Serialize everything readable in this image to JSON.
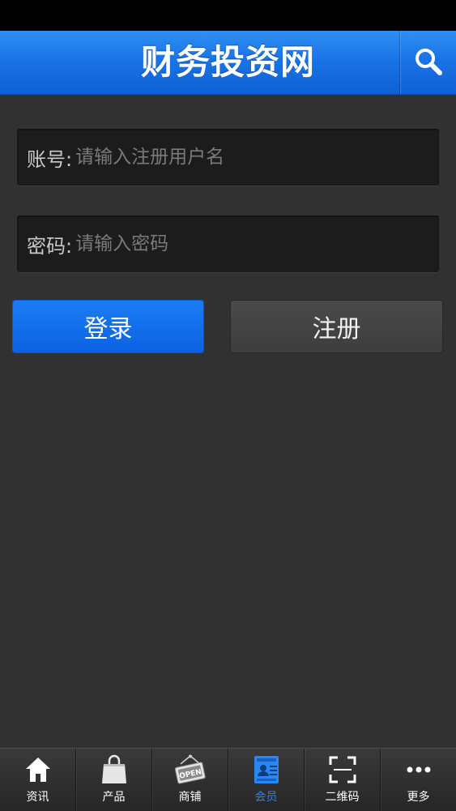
{
  "header": {
    "title": "财务投资网",
    "search_icon": "search-icon"
  },
  "login_form": {
    "account": {
      "label": "账号:",
      "placeholder": "请输入注册用户名",
      "value": ""
    },
    "password": {
      "label": "密码:",
      "placeholder": "请输入密码",
      "value": ""
    },
    "login_button": "登录",
    "register_button": "注册"
  },
  "tabbar": {
    "active": "member",
    "items": [
      {
        "label": "资讯",
        "icon": "home-icon"
      },
      {
        "label": "产品",
        "icon": "shopping-bag-icon"
      },
      {
        "label": "商铺",
        "icon": "open-sign-icon"
      },
      {
        "label": "会员",
        "icon": "member-card-icon"
      },
      {
        "label": "二维码",
        "icon": "qr-scan-icon"
      },
      {
        "label": "更多",
        "icon": "more-icon"
      }
    ]
  },
  "colors": {
    "header_blue": "#1a74e6",
    "login_blue": "#0c62e3",
    "active_tab": "#2a86f0",
    "background": "#313131"
  }
}
